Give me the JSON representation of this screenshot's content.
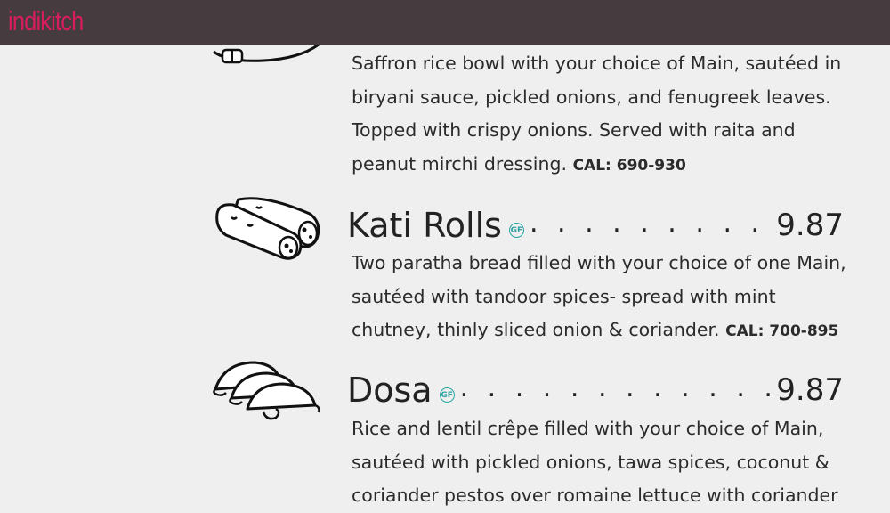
{
  "brand": {
    "logo_text": "indikitch"
  },
  "menu": {
    "items": [
      {
        "name": "",
        "price": "",
        "description": "Saffron rice bowl with your choice of Main, sautéed in biryani sauce, pickled onions, and fenugreek leaves. Topped with crispy onions. Served with raita and peanut mirchi dressing.",
        "cal": "CAL: 690-930"
      },
      {
        "name": "Kati Rolls",
        "badge": "GF",
        "dots": ". . . . . . . . . . . . . . . .",
        "price": "9.87",
        "description": "Two paratha bread filled with your choice of one Main, sautéed with tandoor spices- spread with mint chutney, thinly sliced onion & coriander.",
        "cal": "CAL: 700-895"
      },
      {
        "name": "Dosa",
        "badge": "GF",
        "dots": ". . . . . . . . . . . . . . . . . . . . . .",
        "price": "9.87",
        "description": "Rice and lentil crêpe filled with your choice of Main, sautéed with pickled onions, tawa spices, coconut & coriander pestos over romaine lettuce with coriander",
        "cal": ""
      }
    ]
  },
  "colors": {
    "topbar": "#463c3f",
    "brand": "#d81d5f",
    "badge": "#2aa3a3",
    "background": "#efefef"
  },
  "icons": [
    "bowl-illustration",
    "kati-rolls-illustration",
    "dosa-illustration"
  ]
}
